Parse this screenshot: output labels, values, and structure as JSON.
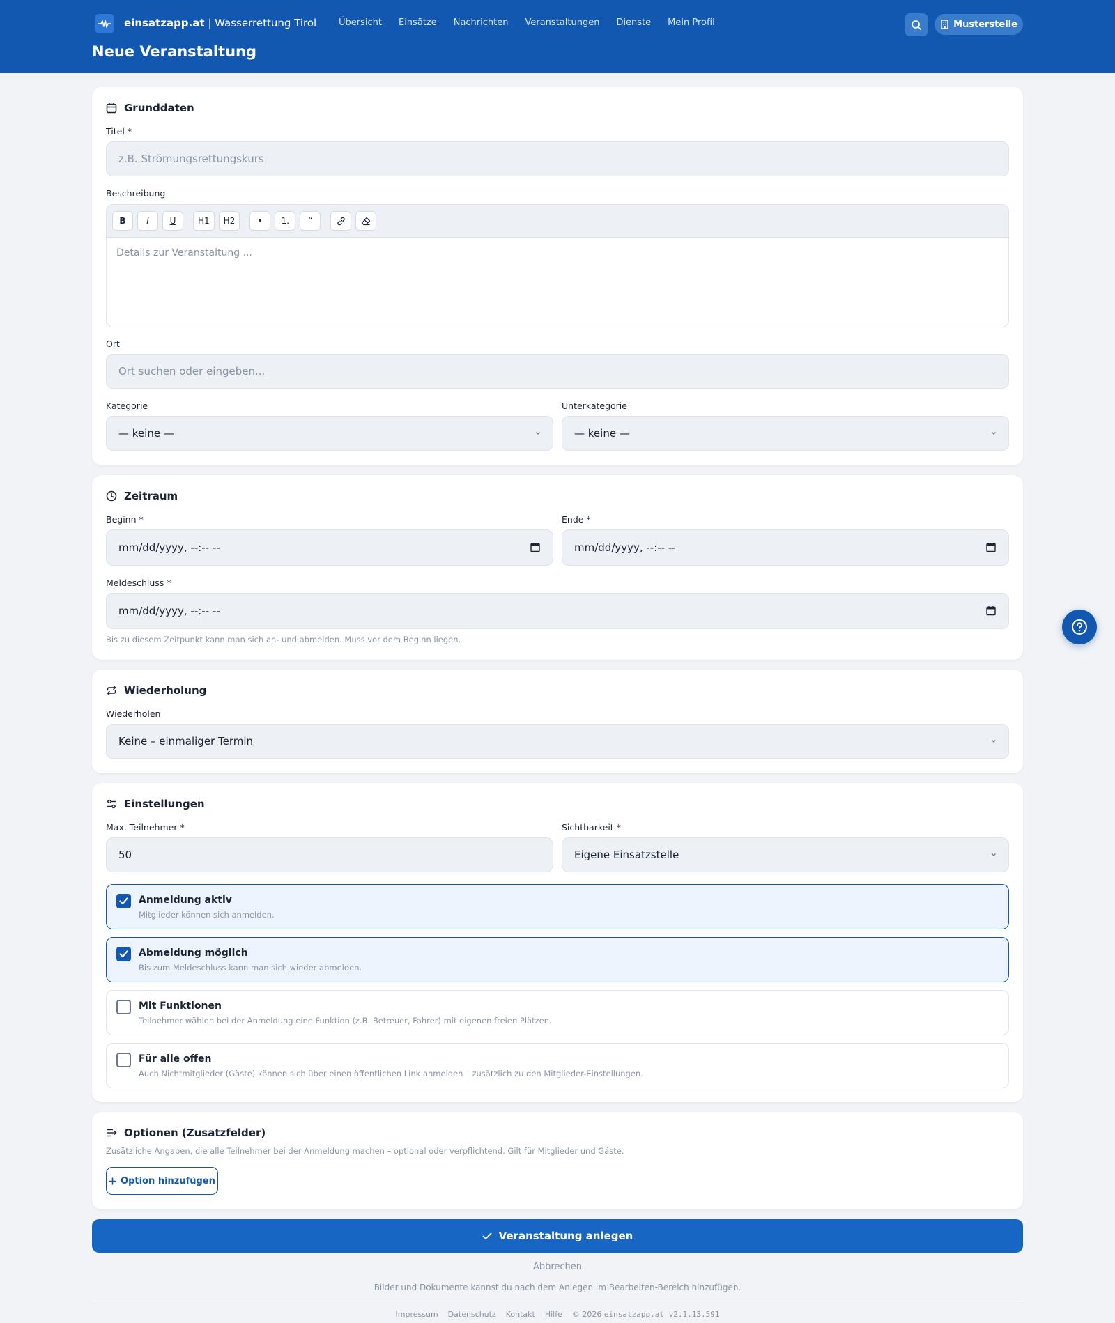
{
  "header": {
    "brand_name": "einsatzapp.at",
    "brand_separator": "|",
    "brand_org": "Wasserrettung Tirol",
    "nav": [
      "Übersicht",
      "Einsätze",
      "Nachrichten",
      "Veranstaltungen",
      "Dienste",
      "Mein Profil"
    ],
    "org_button": "Musterstelle",
    "page_title": "Neue Veranstaltung"
  },
  "grunddaten": {
    "title": "Grunddaten",
    "titel_label": "Titel *",
    "titel_placeholder": "z.B. Strömungsrettungskurs",
    "beschreibung_label": "Beschreibung",
    "toolbar": {
      "bold": "B",
      "italic": "I",
      "underline": "U",
      "h1": "H1",
      "h2": "H2",
      "bullet": "•",
      "ordered": "1.",
      "quote": "“"
    },
    "beschreibung_placeholder": "Details zur Veranstaltung ...",
    "ort_label": "Ort",
    "ort_placeholder": "Ort suchen oder eingeben...",
    "kategorie_label": "Kategorie",
    "kategorie_value": "— keine —",
    "unterkategorie_label": "Unterkategorie",
    "unterkategorie_value": "— keine —"
  },
  "zeitraum": {
    "title": "Zeitraum",
    "beginn_label": "Beginn *",
    "beginn_value": "mm/dd/yyyy, --:-- --",
    "ende_label": "Ende *",
    "ende_value": "mm/dd/yyyy, --:-- --",
    "meldeschluss_label": "Meldeschluss *",
    "meldeschluss_value": "mm/dd/yyyy, --:-- --",
    "meldeschluss_hint": "Bis zu diesem Zeitpunkt kann man sich an- und abmelden. Muss vor dem Beginn liegen."
  },
  "wiederholung": {
    "title": "Wiederholung",
    "label": "Wiederholen",
    "value": "Keine – einmaliger Termin"
  },
  "einstellungen": {
    "title": "Einstellungen",
    "max_label": "Max. Teilnehmer *",
    "max_value": "50",
    "sicht_label": "Sichtbarkeit *",
    "sicht_value": "Eigene Einsatzstelle",
    "options": [
      {
        "title": "Anmeldung aktiv",
        "desc": "Mitglieder können sich anmelden.",
        "checked": true
      },
      {
        "title": "Abmeldung möglich",
        "desc": "Bis zum Meldeschluss kann man sich wieder abmelden.",
        "checked": true
      },
      {
        "title": "Mit Funktionen",
        "desc": "Teilnehmer wählen bei der Anmeldung eine Funktion (z.B. Betreuer, Fahrer) mit eigenen freien Plätzen.",
        "checked": false
      },
      {
        "title": "Für alle offen",
        "desc": "Auch Nichtmitglieder (Gäste) können sich über einen öffentlichen Link anmelden – zusätzlich zu den Mitglieder-Einstellungen.",
        "checked": false
      }
    ]
  },
  "optionen": {
    "title": "Optionen (Zusatzfelder)",
    "desc": "Zusätzliche Angaben, die alle Teilnehmer bei der Anmeldung machen – optional oder verpflichtend. Gilt für Mitglieder und Gäste.",
    "add_button": "Option hinzufügen"
  },
  "actions": {
    "submit": "Veranstaltung anlegen",
    "cancel": "Abbrechen",
    "hint": "Bilder und Dokumente kannst du nach dem Anlegen im Bearbeiten-Bereich hinzufügen."
  },
  "footer": {
    "links": [
      "Impressum",
      "Datenschutz",
      "Kontakt",
      "Hilfe"
    ],
    "copyright": "© 2026",
    "app_version": "einsatzapp.at v2.1.13.591"
  },
  "colors": {
    "primary": "#1257b0",
    "header": "#1257b0",
    "button": "#1866c4",
    "background": "#f1f3f7",
    "field": "#edf0f5"
  },
  "icons": [
    "pulse-logo-icon",
    "search-icon",
    "building-icon",
    "calendar-icon",
    "clock-icon",
    "repeat-icon",
    "sliders-icon",
    "list-plus-icon",
    "chevron-down-icon",
    "check-icon",
    "plus-icon",
    "help-icon"
  ]
}
